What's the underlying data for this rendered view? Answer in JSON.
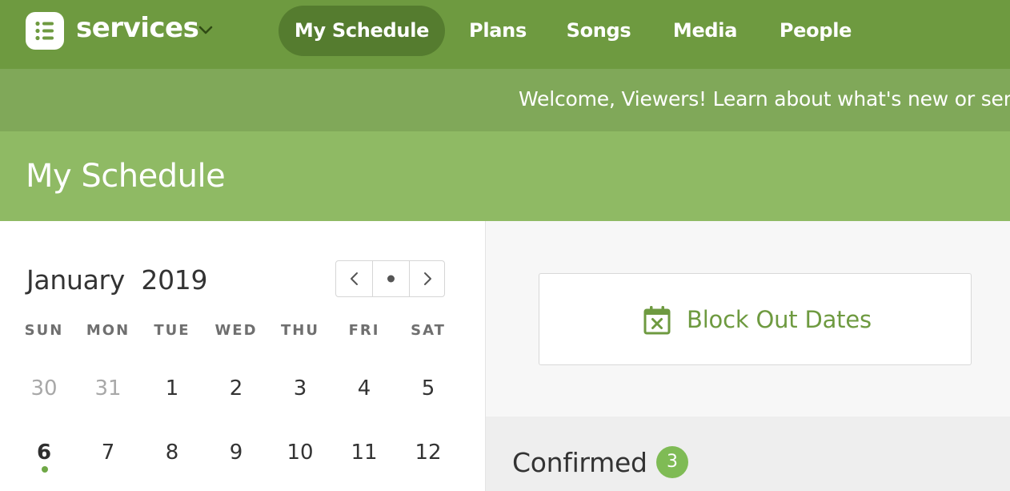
{
  "header": {
    "app_name": "services",
    "nav": [
      {
        "label": "My Schedule",
        "active": true
      },
      {
        "label": "Plans",
        "active": false
      },
      {
        "label": "Songs",
        "active": false
      },
      {
        "label": "Media",
        "active": false
      },
      {
        "label": "People",
        "active": false
      }
    ]
  },
  "banner": {
    "text": "Welcome, Viewers! Learn about what's new or send us feedback"
  },
  "page": {
    "title": "My Schedule"
  },
  "calendar": {
    "month": "January",
    "year": "2019",
    "weekdays": [
      "SUN",
      "MON",
      "TUE",
      "WED",
      "THU",
      "FRI",
      "SAT"
    ],
    "weeks": [
      [
        "30",
        "31",
        "1",
        "2",
        "3",
        "4",
        "5"
      ],
      [
        "6",
        "7",
        "8",
        "9",
        "10",
        "11",
        "12"
      ]
    ],
    "today": "6",
    "nav_icons": [
      "chevron-left-icon",
      "dot-icon",
      "chevron-right-icon"
    ]
  },
  "actions": {
    "block_out_label": "Block Out Dates",
    "block_out_icon": "calendar-x-icon"
  },
  "confirmed": {
    "title": "Confirmed",
    "count": "3"
  },
  "colors": {
    "nav_bar": "#6e9a40",
    "nav_active": "#557c2f",
    "banner": "#80a859",
    "page_header": "#8fba64",
    "accent_text": "#6e9a40",
    "badge": "#7fbb55"
  }
}
